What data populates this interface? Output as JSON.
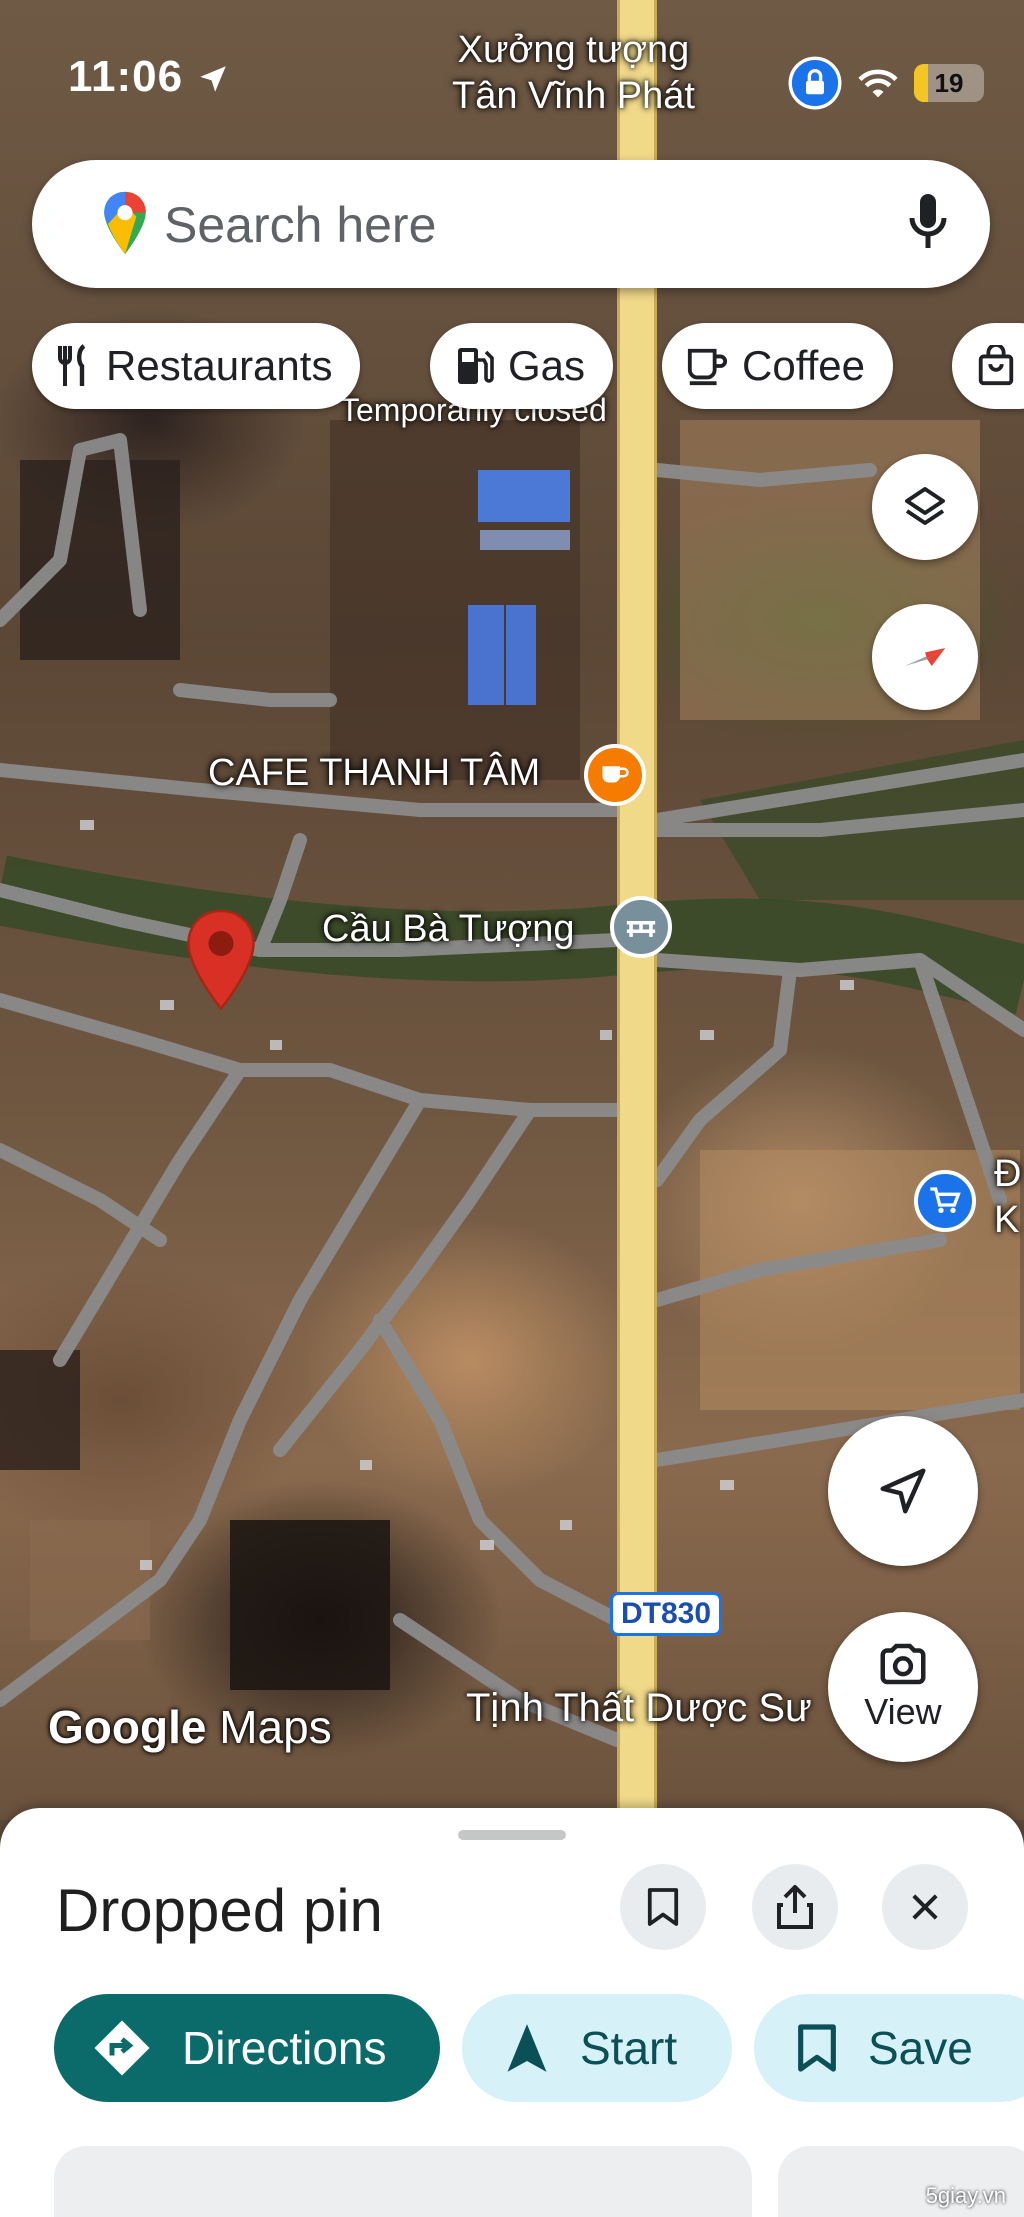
{
  "status_bar": {
    "time": "11:06",
    "battery": "19"
  },
  "map": {
    "labels": {
      "workshop_line1": "Xưởng tượng",
      "workshop_line2": "Tân Vĩnh Phát",
      "temporarily_closed": "Temporarily closed",
      "cafe": "CAFE THANH TÂM",
      "bridge": "Cầu Bà Tượng",
      "right_edge_letter1": "Đ",
      "right_edge_letter2": "K",
      "road_shield": "DT830",
      "temple": "Tịnh Thất Dược Sư"
    },
    "attribution_google": "Google",
    "attribution_maps": "Maps",
    "colors": {
      "cafe_poi": "#f57c00",
      "bridge_poi": "#78909c",
      "shop_poi": "#1a73e8",
      "pin": "#d93025"
    }
  },
  "search": {
    "placeholder": "Search here",
    "icons": [
      "google-maps-logo-icon",
      "mic-icon"
    ]
  },
  "chips": [
    {
      "label": "Restaurants",
      "icon": "fork-knife-icon"
    },
    {
      "label": "Gas",
      "icon": "gas-pump-icon"
    },
    {
      "label": "Coffee",
      "icon": "coffee-cup-icon"
    },
    {
      "label": "",
      "icon": "shopping-bag-icon"
    }
  ],
  "map_controls": {
    "view_label": "View"
  },
  "sheet": {
    "title": "Dropped pin",
    "actions": [
      {
        "label": "Directions",
        "icon": "directions-icon"
      },
      {
        "label": "Start",
        "icon": "navigation-arrow-icon"
      },
      {
        "label": "Save",
        "icon": "bookmark-icon"
      }
    ]
  },
  "watermark": "5giay.vn",
  "accent": "#0b6b6b"
}
